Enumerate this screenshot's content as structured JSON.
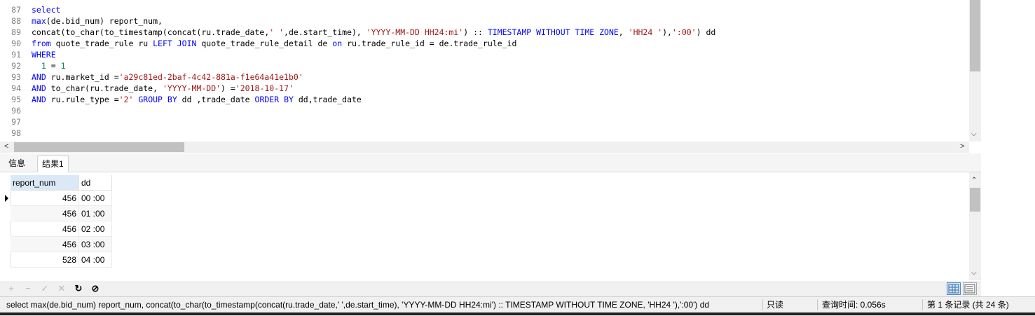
{
  "editor": {
    "lines": [
      {
        "n": "87",
        "tokens": [
          {
            "t": "select",
            "c": "kw"
          }
        ]
      },
      {
        "n": "88",
        "tokens": [
          {
            "t": "max",
            "c": "kw"
          },
          {
            "t": "(de.bid_num) report_num,",
            "c": ""
          }
        ]
      },
      {
        "n": "89",
        "tokens": [
          {
            "t": "concat(to_char(to_timestamp(concat(ru.trade_date,",
            "c": ""
          },
          {
            "t": "' '",
            "c": "str"
          },
          {
            "t": ",de.start_time), ",
            "c": ""
          },
          {
            "t": "'YYYY-MM-DD HH24:mi'",
            "c": "str"
          },
          {
            "t": ") :: ",
            "c": ""
          },
          {
            "t": "TIMESTAMP WITHOUT TIME ZONE",
            "c": "kw"
          },
          {
            "t": ", ",
            "c": ""
          },
          {
            "t": "'HH24 '",
            "c": "str"
          },
          {
            "t": "),",
            "c": ""
          },
          {
            "t": "':00'",
            "c": "str"
          },
          {
            "t": ") dd",
            "c": ""
          }
        ]
      },
      {
        "n": "90",
        "tokens": [
          {
            "t": "from",
            "c": "kw"
          },
          {
            "t": " quote_trade_rule ru ",
            "c": ""
          },
          {
            "t": "LEFT JOIN",
            "c": "kw"
          },
          {
            "t": " quote_trade_rule_detail de ",
            "c": ""
          },
          {
            "t": "on",
            "c": "kw"
          },
          {
            "t": " ru.trade_rule_id = de.trade_rule_id",
            "c": ""
          }
        ]
      },
      {
        "n": "91",
        "tokens": [
          {
            "t": "WHERE",
            "c": "kw"
          }
        ]
      },
      {
        "n": "92",
        "tokens": [
          {
            "t": "  ",
            "c": ""
          },
          {
            "t": "1",
            "c": "num"
          },
          {
            "t": " = ",
            "c": ""
          },
          {
            "t": "1",
            "c": "num"
          }
        ]
      },
      {
        "n": "93",
        "tokens": [
          {
            "t": "AND",
            "c": "kw"
          },
          {
            "t": " ru.market_id =",
            "c": ""
          },
          {
            "t": "'a29c81ed-2baf-4c42-881a-f1e64a41e1b0'",
            "c": "str"
          }
        ]
      },
      {
        "n": "94",
        "tokens": [
          {
            "t": "AND",
            "c": "kw"
          },
          {
            "t": " to_char(ru.trade_date, ",
            "c": ""
          },
          {
            "t": "'YYYY-MM-DD'",
            "c": "str"
          },
          {
            "t": ") =",
            "c": ""
          },
          {
            "t": "'2018-10-17'",
            "c": "str"
          }
        ]
      },
      {
        "n": "95",
        "tokens": [
          {
            "t": "AND",
            "c": "kw"
          },
          {
            "t": " ru.rule_type =",
            "c": ""
          },
          {
            "t": "'2'",
            "c": "str"
          },
          {
            "t": " ",
            "c": ""
          },
          {
            "t": "GROUP BY",
            "c": "kw"
          },
          {
            "t": " dd ,trade_date ",
            "c": ""
          },
          {
            "t": "ORDER BY",
            "c": "kw"
          },
          {
            "t": " dd,trade_date",
            "c": ""
          }
        ]
      },
      {
        "n": "96",
        "tokens": []
      },
      {
        "n": "97",
        "tokens": []
      },
      {
        "n": "98",
        "tokens": []
      }
    ]
  },
  "tabs": [
    {
      "label": "信息",
      "active": false
    },
    {
      "label": "结果1",
      "active": true
    }
  ],
  "grid": {
    "columns": [
      "report_num",
      "dd"
    ],
    "rows": [
      [
        "456",
        "00 :00"
      ],
      [
        "456",
        "01 :00"
      ],
      [
        "456",
        "02 :00"
      ],
      [
        "456",
        "03 :00"
      ],
      [
        "528",
        "04 :00"
      ]
    ]
  },
  "toolbar": {
    "add": "+",
    "remove": "−",
    "apply": "✓",
    "discard": "✕",
    "refresh": "↻",
    "stop": "⊘"
  },
  "status": {
    "query": "select  max(de.bid_num) report_num, concat(to_char(to_timestamp(concat(ru.trade_date,' ',de.start_time), 'YYYY-MM-DD HH24:mi') :: TIMESTAMP WITHOUT TIME ZONE, 'HH24 '),':00') dd",
    "readonly": "只读",
    "query_time": "查询时间: 0.056s",
    "records": "第 1 条记录 (共 24 条)"
  },
  "colors": {
    "keyword": "#0000ff",
    "string": "#a31515",
    "number": "#098658",
    "selection": "#dbe9f7"
  }
}
